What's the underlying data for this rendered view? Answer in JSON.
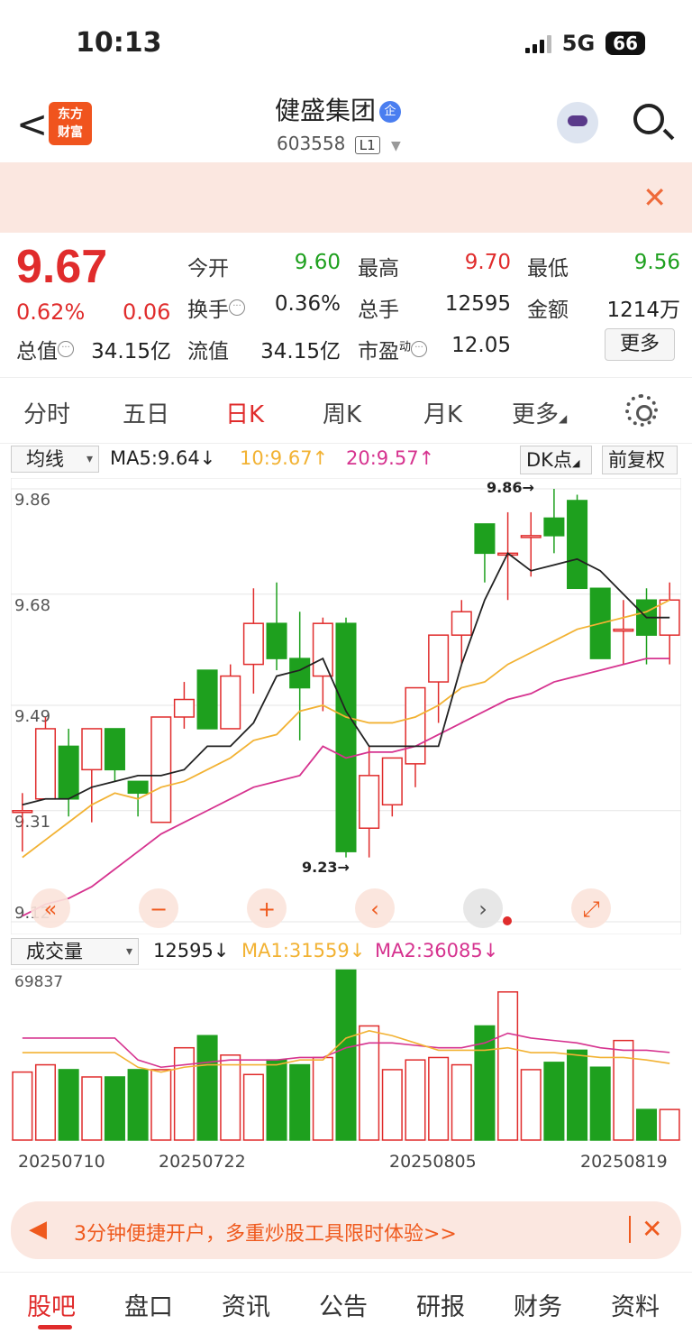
{
  "status": {
    "time": "10:13",
    "network": "5G",
    "battery": "66"
  },
  "header": {
    "logo_line1": "东方",
    "logo_line2": "财富",
    "stock_name": "健盛集团",
    "ent_badge": "企",
    "stock_code": "603558",
    "level": "L1"
  },
  "quote": {
    "price": "9.67",
    "change_pct": "0.62%",
    "change": "0.06",
    "open_label": "今开",
    "open": "9.60",
    "high_label": "最高",
    "high": "9.70",
    "low_label": "最低",
    "low": "9.56",
    "turnover_label": "换手",
    "turnover": "0.36%",
    "volume_label": "总手",
    "volume": "12595",
    "amount_label": "金额",
    "amount": "1214万",
    "mktcap_label": "总值",
    "mktcap": "34.15亿",
    "float_label": "流值",
    "float": "34.15亿",
    "pe_label": "市盈",
    "pe_sup": "动",
    "pe": "12.05",
    "more_button": "更多"
  },
  "tabs": [
    "分时",
    "五日",
    "日K",
    "周K",
    "月K",
    "更多"
  ],
  "active_tab": "日K",
  "indicator_bar": {
    "select": "均线",
    "ma5": "MA5:9.64↓",
    "ma10": "10:9.67↑",
    "ma20": "20:9.57↑",
    "dk_button": "DK点",
    "adjust_button": "前复权"
  },
  "volume_bar": {
    "select": "成交量",
    "vol": "12595↓",
    "ma1": "MA1:31559↓",
    "ma2": "MA2:36085↓"
  },
  "colors": {
    "up": "#e02c2c",
    "down": "#1ea01e",
    "ma5": "#222222",
    "ma10": "#f2b233",
    "ma20": "#d6338f",
    "accent": "#ef5a1e"
  },
  "chart_data": [
    {
      "type": "candlestick",
      "y_ticks": [
        "9.86",
        "9.68",
        "9.49",
        "9.31",
        "9.12"
      ],
      "ylim": [
        9.12,
        9.86
      ],
      "annotations": [
        "9.86→",
        "9.23→"
      ],
      "candles": [
        {
          "o": 9.31,
          "h": 9.34,
          "l": 9.24,
          "c": 9.31
        },
        {
          "o": 9.33,
          "h": 9.47,
          "l": 9.33,
          "c": 9.45
        },
        {
          "o": 9.42,
          "h": 9.45,
          "l": 9.3,
          "c": 9.33
        },
        {
          "o": 9.38,
          "h": 9.45,
          "l": 9.29,
          "c": 9.45
        },
        {
          "o": 9.45,
          "h": 9.45,
          "l": 9.36,
          "c": 9.38
        },
        {
          "o": 9.36,
          "h": 9.36,
          "l": 9.3,
          "c": 9.34
        },
        {
          "o": 9.29,
          "h": 9.47,
          "l": 9.29,
          "c": 9.47
        },
        {
          "o": 9.47,
          "h": 9.53,
          "l": 9.45,
          "c": 9.5
        },
        {
          "o": 9.55,
          "h": 9.55,
          "l": 9.45,
          "c": 9.45
        },
        {
          "o": 9.45,
          "h": 9.56,
          "l": 9.45,
          "c": 9.54
        },
        {
          "o": 9.56,
          "h": 9.69,
          "l": 9.51,
          "c": 9.63
        },
        {
          "o": 9.63,
          "h": 9.7,
          "l": 9.55,
          "c": 9.57
        },
        {
          "o": 9.57,
          "h": 9.65,
          "l": 9.43,
          "c": 9.52
        },
        {
          "o": 9.54,
          "h": 9.64,
          "l": 9.48,
          "c": 9.63
        },
        {
          "o": 9.63,
          "h": 9.64,
          "l": 9.23,
          "c": 9.24
        },
        {
          "o": 9.28,
          "h": 9.42,
          "l": 9.23,
          "c": 9.37
        },
        {
          "o": 9.32,
          "h": 9.4,
          "l": 9.3,
          "c": 9.4
        },
        {
          "o": 9.39,
          "h": 9.52,
          "l": 9.35,
          "c": 9.52
        },
        {
          "o": 9.53,
          "h": 9.58,
          "l": 9.46,
          "c": 9.61
        },
        {
          "o": 9.61,
          "h": 9.67,
          "l": 9.56,
          "c": 9.65
        },
        {
          "o": 9.8,
          "h": 9.8,
          "l": 9.7,
          "c": 9.75
        },
        {
          "o": 9.75,
          "h": 9.82,
          "l": 9.67,
          "c": 9.75
        },
        {
          "o": 9.78,
          "h": 9.82,
          "l": 9.71,
          "c": 9.78
        },
        {
          "o": 9.81,
          "h": 9.86,
          "l": 9.75,
          "c": 9.78
        },
        {
          "o": 9.84,
          "h": 9.85,
          "l": 9.7,
          "c": 9.69
        },
        {
          "o": 9.69,
          "h": 9.69,
          "l": 9.57,
          "c": 9.57
        },
        {
          "o": 9.62,
          "h": 9.67,
          "l": 9.56,
          "c": 9.62
        },
        {
          "o": 9.67,
          "h": 9.69,
          "l": 9.56,
          "c": 9.61
        },
        {
          "o": 9.61,
          "h": 9.7,
          "l": 9.56,
          "c": 9.67
        }
      ],
      "ma5": [
        9.32,
        9.33,
        9.33,
        9.35,
        9.36,
        9.37,
        9.37,
        9.38,
        9.42,
        9.42,
        9.46,
        9.54,
        9.55,
        9.57,
        9.48,
        9.42,
        9.42,
        9.42,
        9.42,
        9.56,
        9.67,
        9.75,
        9.72,
        9.73,
        9.74,
        9.72,
        9.68,
        9.64,
        9.64
      ],
      "ma10": [
        9.23,
        9.26,
        9.29,
        9.32,
        9.34,
        9.33,
        9.35,
        9.36,
        9.38,
        9.4,
        9.43,
        9.44,
        9.48,
        9.49,
        9.47,
        9.46,
        9.46,
        9.47,
        9.49,
        9.52,
        9.53,
        9.56,
        9.58,
        9.6,
        9.62,
        9.63,
        9.64,
        9.65,
        9.67
      ],
      "ma20": [
        9.13,
        9.15,
        9.16,
        9.18,
        9.21,
        9.24,
        9.27,
        9.29,
        9.31,
        9.33,
        9.35,
        9.36,
        9.37,
        9.42,
        9.4,
        9.41,
        9.41,
        9.42,
        9.44,
        9.46,
        9.48,
        9.5,
        9.51,
        9.53,
        9.54,
        9.55,
        9.56,
        9.57,
        9.57
      ]
    },
    {
      "type": "bar",
      "y_ticks": [
        "69837"
      ],
      "x_ticks": [
        "20250710",
        "20250722",
        "20250805",
        "20250819"
      ],
      "ylim": [
        0,
        69837
      ],
      "values": [
        28000,
        31000,
        29000,
        26000,
        26000,
        29000,
        29000,
        38000,
        43000,
        35000,
        27000,
        33000,
        31000,
        34000,
        70000,
        47000,
        29000,
        33000,
        34000,
        31000,
        47000,
        61000,
        29000,
        32000,
        37000,
        30000,
        41000,
        12595,
        12595
      ],
      "ma1": [
        36000,
        36000,
        36000,
        36000,
        36000,
        30000,
        28000,
        30000,
        31000,
        31000,
        31000,
        31000,
        33000,
        33000,
        42000,
        45000,
        43000,
        40000,
        37000,
        37000,
        37000,
        38000,
        36000,
        36000,
        35000,
        34000,
        34000,
        33000,
        31559
      ],
      "ma2": [
        42000,
        42000,
        42000,
        42000,
        42000,
        33000,
        30000,
        31000,
        32000,
        33000,
        33000,
        33000,
        34000,
        34000,
        38000,
        40000,
        40000,
        39000,
        38000,
        38000,
        40000,
        44000,
        42000,
        41000,
        40000,
        38000,
        37000,
        37000,
        36085
      ]
    }
  ],
  "chart_buttons": [
    "«",
    "−",
    "+",
    "‹",
    "›",
    "⤢"
  ],
  "promo": {
    "text": "3分钟便捷开户，多重炒股工具限时体验>>",
    "close": "✕"
  },
  "bottom_tabs": [
    "股吧",
    "盘口",
    "资讯",
    "公告",
    "研报",
    "财务",
    "资料"
  ],
  "banner_close": "✕"
}
